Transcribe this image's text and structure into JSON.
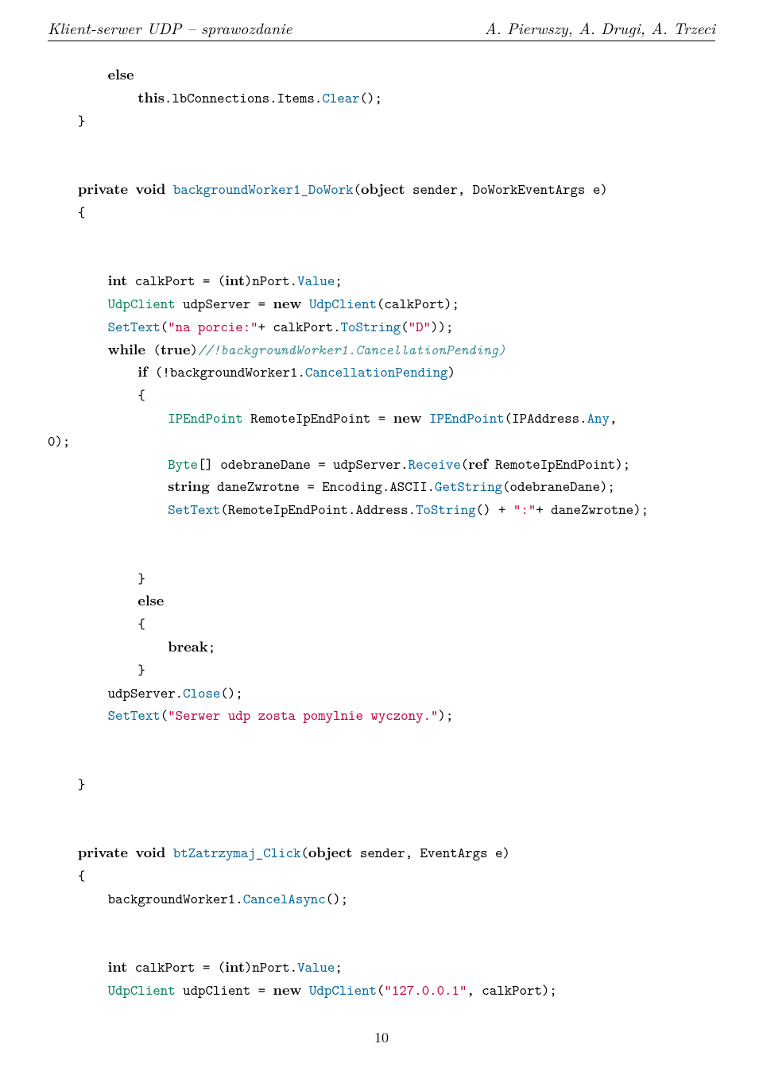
{
  "header": {
    "left": "Klient-serwer UDP – sprawozdanie",
    "right": "A. Pierwszy, A. Drugi, A. Trzeci"
  },
  "page_number": "10",
  "code": {
    "l1_kw_else": "else",
    "l2_kw_this": "this",
    "l2_rest": ".lbConnections.Items.",
    "l2_fn": "Clear",
    "l2_paren": "();",
    "l3_brace": "}",
    "l5_kw_private": "private",
    "l5_kw_void": "void",
    "l5_fn": "backgroundWorker1_DoWork",
    "l5_obj": "object",
    "l5_rest": " sender, DoWorkEventArgs e)",
    "l6_brace": "{",
    "l8_kw_int": "int",
    "l8_rest1": " calkPort = (",
    "l8_kw_int2": "int",
    "l8_rest2": ")nPort.",
    "l8_fn": "Value",
    "l8_semi": ";",
    "l9_typ": "UdpClient",
    "l9_rest1": " udpServer = ",
    "l9_kw_new": "new",
    "l9_fn": "UdpClient",
    "l9_rest2": "(calkPort);",
    "l10_fn": "SetText",
    "l10_lit1": "\"na porcie:\"",
    "l10_rest1": "+ calkPort.",
    "l10_fn2": "ToString",
    "l10_lit2": "\"D\"",
    "l10_rest2": "));",
    "l11_kw_while": "while",
    "l11_rest": " (",
    "l11_kw_true": "true",
    "l11_rest2": ")",
    "l11_com": "//!backgroundWorker1.CancellationPending)",
    "l12_kw_if": "if",
    "l12_rest": " (!backgroundWorker1.",
    "l12_fn": "CancellationPending",
    "l12_rest2": ")",
    "l13_brace": "{",
    "l14_typ": "IPEndPoint",
    "l14_rest1": " RemoteIpEndPoint = ",
    "l14_kw_new": "new",
    "l14_fn": "IPEndPoint",
    "l14_rest2": "(IPAddress.",
    "l14_fn2": "Any",
    "l14_rest3": ",",
    "l15": "0);",
    "l16_typ": "Byte",
    "l16_rest1": "[] odebraneDane = udpServer.",
    "l16_fn": "Receive",
    "l16_kw_ref": "ref",
    "l16_rest2": " RemoteIpEndPoint);",
    "l17_kw_string": "string",
    "l17_rest1": " daneZwrotne = Encoding.ASCII.",
    "l17_fn": "GetString",
    "l17_rest2": "(odebraneDane);",
    "l18_fn": "SetText",
    "l18_rest1": "(RemoteIpEndPoint.Address.",
    "l18_fn2": "ToString",
    "l18_rest2": "() + ",
    "l18_lit": "\":\"",
    "l18_rest3": "+ daneZwrotne);",
    "l20_brace": "}",
    "l21_kw_else": "else",
    "l22_brace": "{",
    "l23_kw_break": "break",
    "l23_semi": ";",
    "l24_brace": "}",
    "l25_rest": "udpServer.",
    "l25_fn": "Close",
    "l25_rest2": "();",
    "l26_fn": "SetText",
    "l26_lit": "\"Serwer udp zosta pomylnie wyczony.\"",
    "l26_rest": ");",
    "l28_brace": "}",
    "l30_kw_private": "private",
    "l30_kw_void": "void",
    "l30_fn": "btZatrzymaj_Click",
    "l30_obj": "object",
    "l30_rest": " sender, EventArgs e)",
    "l31_brace": "{",
    "l32_rest": "backgroundWorker1.",
    "l32_fn": "CancelAsync",
    "l32_rest2": "();",
    "l34_kw_int": "int",
    "l34_rest1": " calkPort = (",
    "l34_kw_int2": "int",
    "l34_rest2": ")nPort.",
    "l34_fn": "Value",
    "l34_semi": ";",
    "l35_typ": "UdpClient",
    "l35_rest1": " udpClient = ",
    "l35_kw_new": "new",
    "l35_fn": "UdpClient",
    "l35_lit": "\"127.0.0.1\"",
    "l35_rest2": ", calkPort);"
  }
}
